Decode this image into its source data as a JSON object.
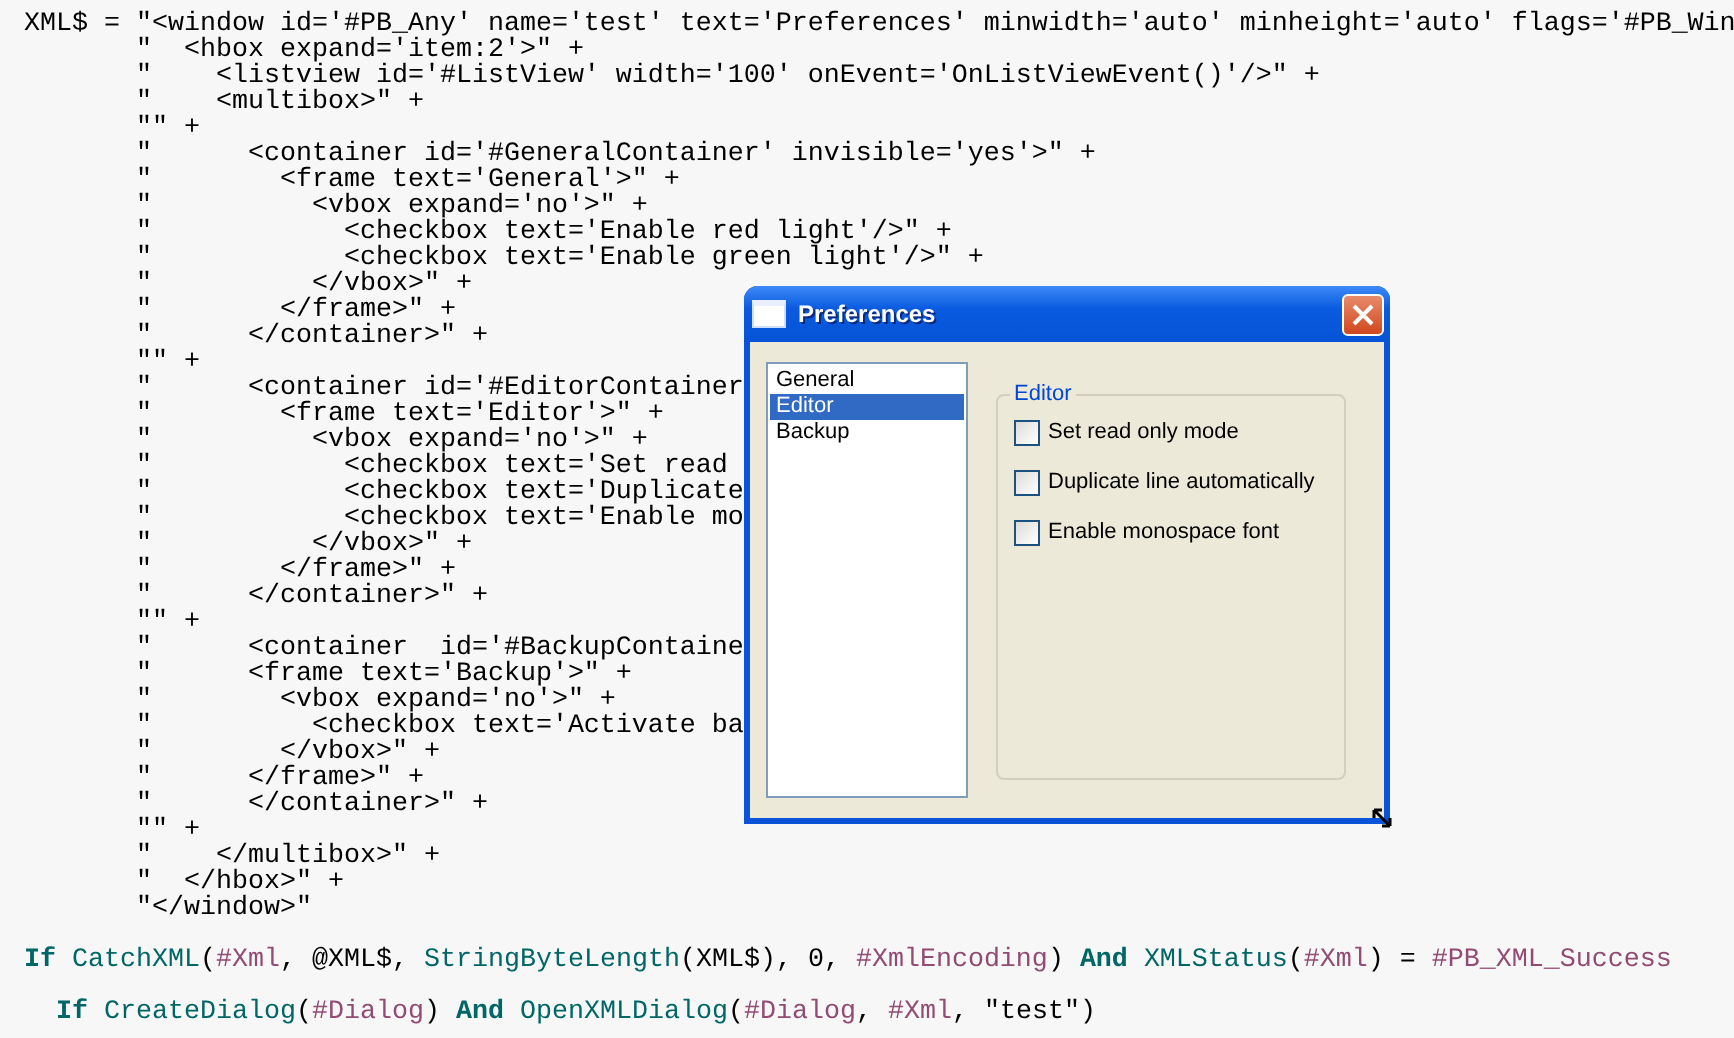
{
  "code": {
    "lines": [
      {
        "text": "XML$ = \"<window id='#PB_Any' name='test' text='Preferences' minwidth='auto' minheight='auto' flags='#PB_Win"
      },
      {
        "text": "       \"  <hbox expand='item:2'>\" +"
      },
      {
        "text": "       \"    <listview id='#ListView' width='100' onEvent='OnListViewEvent()'/>\" +"
      },
      {
        "text": "       \"    <multibox>\" +"
      },
      {
        "text": "       \"\" +"
      },
      {
        "text": "       \"      <container id='#GeneralContainer' invisible='yes'>\" +"
      },
      {
        "text": "       \"        <frame text='General'>\" +"
      },
      {
        "text": "       \"          <vbox expand='no'>\" +"
      },
      {
        "text": "       \"            <checkbox text='Enable red light'/>\" +"
      },
      {
        "text": "       \"            <checkbox text='Enable green light'/>\" +"
      },
      {
        "text": "       \"          </vbox>\" +"
      },
      {
        "text": "       \"        </frame>\" +"
      },
      {
        "text": "       \"      </container>\" +"
      },
      {
        "text": "       \"\" +"
      },
      {
        "text": "       \"      <container id='#EditorContainer"
      },
      {
        "text": "       \"        <frame text='Editor'>\" +"
      },
      {
        "text": "       \"          <vbox expand='no'>\" +"
      },
      {
        "text": "       \"            <checkbox text='Set read"
      },
      {
        "text": "       \"            <checkbox text='Duplicate"
      },
      {
        "text": "       \"            <checkbox text='Enable mo"
      },
      {
        "text": "       \"          </vbox>\" +"
      },
      {
        "text": "       \"        </frame>\" +"
      },
      {
        "text": "       \"      </container>\" +"
      },
      {
        "text": "       \"\" +"
      },
      {
        "text": "       \"      <container  id='#BackupContaine"
      },
      {
        "text": "       \"      <frame text='Backup'>\" +"
      },
      {
        "text": "       \"        <vbox expand='no'>\" +"
      },
      {
        "text": "       \"          <checkbox text='Activate ba"
      },
      {
        "text": "       \"        </vbox>\" +"
      },
      {
        "text": "       \"      </frame>\" +"
      },
      {
        "text": "       \"      </container>\" +"
      },
      {
        "text": "       \"\" +"
      },
      {
        "text": "       \"    </multibox>\" +"
      },
      {
        "text": "       \"  </hbox>\" +"
      },
      {
        "text": "       \"</window>\""
      }
    ],
    "statements": [
      {
        "tokens": [
          {
            "kind": "keyword",
            "text": "If "
          },
          {
            "kind": "function",
            "text": "CatchXML"
          },
          {
            "kind": "plain",
            "text": "("
          },
          {
            "kind": "constant",
            "text": "#Xml"
          },
          {
            "kind": "plain",
            "text": ", @XML$, "
          },
          {
            "kind": "function",
            "text": "StringByteLength"
          },
          {
            "kind": "plain",
            "text": "(XML$), 0, "
          },
          {
            "kind": "constant",
            "text": "#XmlEncoding"
          },
          {
            "kind": "plain",
            "text": ") "
          },
          {
            "kind": "keyword",
            "text": "And "
          },
          {
            "kind": "function",
            "text": "XMLStatus"
          },
          {
            "kind": "plain",
            "text": "("
          },
          {
            "kind": "constant",
            "text": "#Xml"
          },
          {
            "kind": "plain",
            "text": ") = "
          },
          {
            "kind": "constant",
            "text": "#PB_XML_Success"
          }
        ]
      },
      {
        "tokens": [
          {
            "kind": "keyword",
            "text": "  If "
          },
          {
            "kind": "function",
            "text": "CreateDialog"
          },
          {
            "kind": "plain",
            "text": "("
          },
          {
            "kind": "constant",
            "text": "#Dialog"
          },
          {
            "kind": "plain",
            "text": ") "
          },
          {
            "kind": "keyword",
            "text": "And "
          },
          {
            "kind": "function",
            "text": "OpenXMLDialog"
          },
          {
            "kind": "plain",
            "text": "("
          },
          {
            "kind": "constant",
            "text": "#Dialog"
          },
          {
            "kind": "plain",
            "text": ", "
          },
          {
            "kind": "constant",
            "text": "#Xml"
          },
          {
            "kind": "plain",
            "text": ", \"test\")"
          }
        ]
      }
    ]
  },
  "dialog": {
    "title": "Preferences",
    "list_items": [
      {
        "label": "General",
        "selected": false
      },
      {
        "label": "Editor",
        "selected": true
      },
      {
        "label": "Backup",
        "selected": false
      }
    ],
    "frame": {
      "title": "Editor",
      "checkboxes": [
        {
          "label": "Set read only mode",
          "checked": false
        },
        {
          "label": "Duplicate line automatically",
          "checked": false
        },
        {
          "label": "Enable monospace font",
          "checked": false
        }
      ]
    }
  }
}
